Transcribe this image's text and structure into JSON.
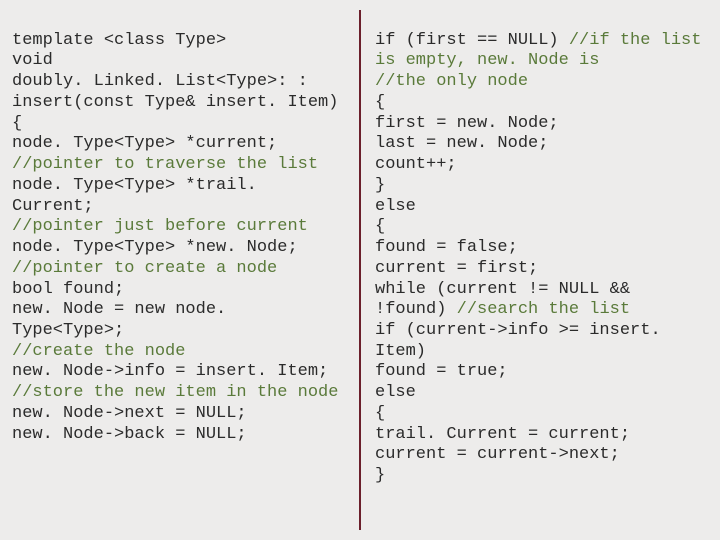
{
  "left": {
    "t1": "template <class Type>",
    "t2": "void",
    "t3": "doubly. Linked. List<Type>: : insert(const Type& insert. Item)",
    "t4": "{",
    "t5": "node. Type<Type> *current;",
    "t6": "//pointer to traverse the list",
    "t7": "node. Type<Type> *trail. Current;",
    "t8": "//pointer just before current",
    "t9": "node. Type<Type> *new. Node;",
    "t10": "//pointer to create a node",
    "t11": "bool found;",
    "t12": "new. Node = new node. Type<Type>;",
    "t13": "//create the node",
    "t14": "new. Node->info = insert. Item;",
    "t15": "//store the new item in the node",
    "t16": "new. Node->next = NULL;",
    "t17": "new. Node->back = NULL;"
  },
  "right": {
    "r1a": "if (first == NULL) ",
    "r1b": "//if the list is empty, new. Node is",
    "r2": "//the only node",
    "r3": "{",
    "r4": "first = new. Node;",
    "r5": "last = new. Node;",
    "r6": "count++;",
    "r7": "}",
    "r8": "else",
    "r9": "{",
    "r10": "found = false;",
    "r11": "current = first;",
    "r12a": "while (current != NULL && !found) ",
    "r12b": "//search the list",
    "r13": "if (current->info >= insert. Item)",
    "r14": "found = true;",
    "r15": "else",
    "r16": "{",
    "r17": "trail. Current = current;",
    "r18": "current = current->next;",
    "r19": "}"
  }
}
